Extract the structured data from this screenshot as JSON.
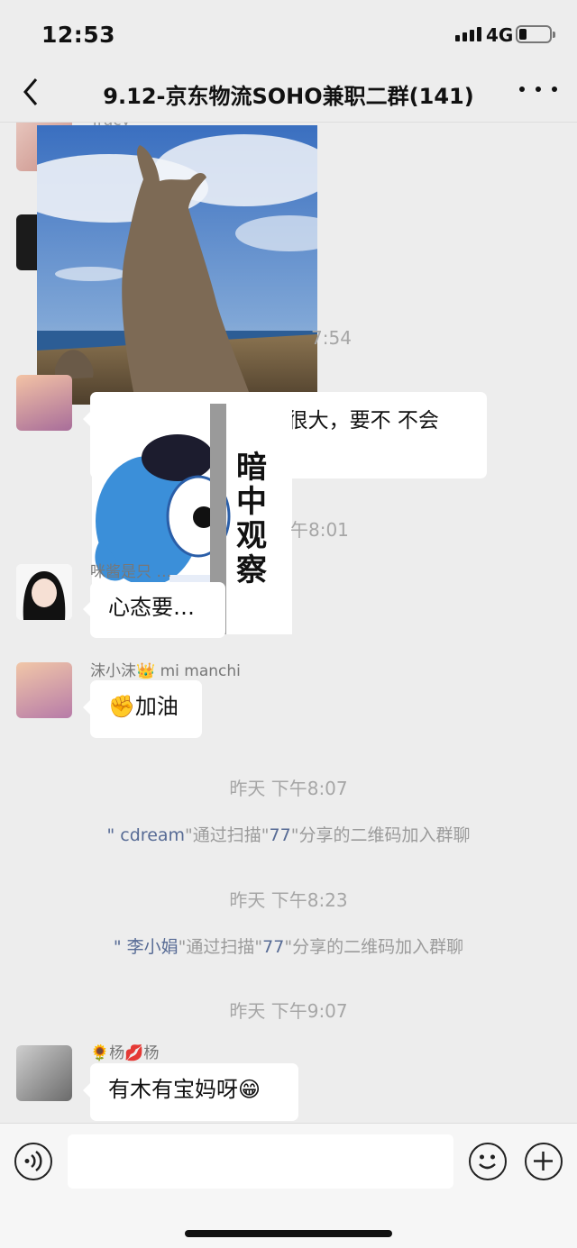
{
  "status_bar": {
    "time": "12:53",
    "network": "4G"
  },
  "header": {
    "title": "9.12-京东物流SOHO兼职二群(141)"
  },
  "messages": {
    "m1_name_fragment": "Tracy",
    "m3_text": "做这个人 …… 肯定很大，要不 不会 …… 么多人",
    "m4_name": "咪酱是只 …",
    "m4_text": "心态要…",
    "m5_name": "沫小沫👑  mi manchi",
    "m5_text": "✊加油",
    "m6_name": "🌻杨💋杨",
    "m6_text": "有木有宝妈呀😁"
  },
  "overlays": {
    "ts_partial_1": "7:54",
    "ts_partial_2": "午8:01",
    "sticker_caption": "暗中观察"
  },
  "timestamps": {
    "t1": "昨天 下午8:07",
    "t2": "昨天 下午8:23",
    "t3": "昨天 下午9:07"
  },
  "system_messages": {
    "s1_user": "\" cdream",
    "s1_mid": "\"通过扫描\"",
    "s1_inviter": "77",
    "s1_tail": "\"分享的二维码加入群聊",
    "s2_user": "\" 李小娟",
    "s2_mid": "\"通过扫描\"",
    "s2_inviter": "77",
    "s2_tail": "\"分享的二维码加入群聊"
  },
  "icons": [
    "back-icon",
    "more-icon",
    "voice-icon",
    "emoji-icon",
    "add-icon"
  ],
  "colors": {
    "bg": "#ededed",
    "link": "#576b95",
    "bubble": "#ffffff"
  }
}
